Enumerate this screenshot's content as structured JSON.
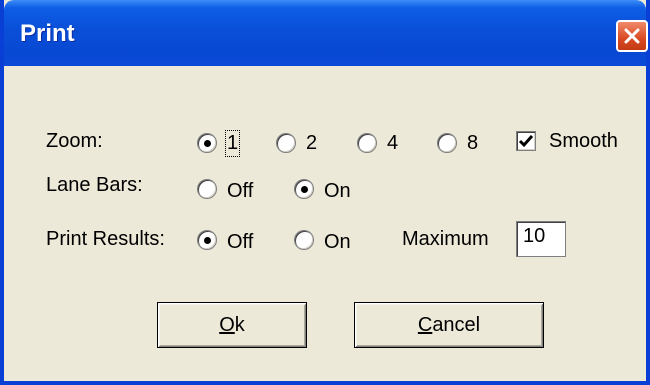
{
  "window": {
    "title": "Print"
  },
  "zoom": {
    "label": "Zoom:",
    "options": [
      {
        "label": "1",
        "checked": true
      },
      {
        "label": "2",
        "checked": false
      },
      {
        "label": "4",
        "checked": false
      },
      {
        "label": "8",
        "checked": false
      }
    ],
    "smooth": {
      "label": "Smooth",
      "checked": true
    }
  },
  "lane_bars": {
    "label": "Lane Bars:",
    "options": [
      {
        "label": "Off",
        "checked": false
      },
      {
        "label": "On",
        "checked": true
      }
    ]
  },
  "print_results": {
    "label": "Print Results:",
    "options": [
      {
        "label": "Off",
        "checked": true
      },
      {
        "label": "On",
        "checked": false
      }
    ],
    "maximum_label": "Maximum",
    "maximum_value": "10"
  },
  "buttons": {
    "ok_mnemonic": "O",
    "ok_rest": "k",
    "cancel_mnemonic": "C",
    "cancel_rest": "ancel"
  }
}
